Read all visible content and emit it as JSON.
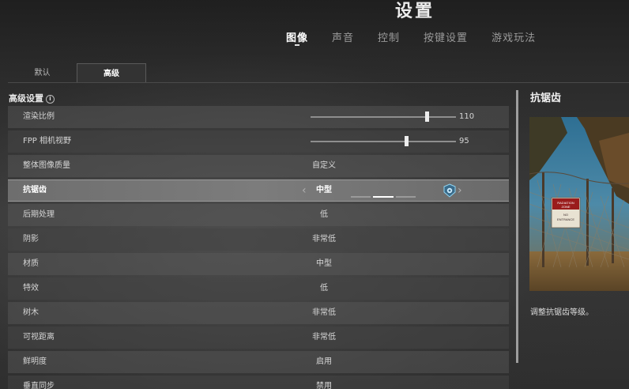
{
  "header": {
    "title": "设置",
    "tabs": [
      {
        "label": "图像",
        "active": true
      },
      {
        "label": "声音",
        "active": false
      },
      {
        "label": "控制",
        "active": false
      },
      {
        "label": "按键设置",
        "active": false
      },
      {
        "label": "游戏玩法",
        "active": false
      }
    ]
  },
  "subtabs": [
    {
      "label": "默认",
      "active": false
    },
    {
      "label": "高级",
      "active": true
    }
  ],
  "section": {
    "title": "高级设置",
    "info_icon": "i"
  },
  "settings": [
    {
      "label": "渲染比例",
      "type": "slider",
      "value": "110",
      "fraction": 0.8
    },
    {
      "label": "FPP 相机视野",
      "type": "slider",
      "value": "95",
      "fraction": 0.66
    },
    {
      "label": "整体图像质量",
      "type": "option",
      "value": "自定义"
    },
    {
      "label": "抗锯齿",
      "type": "selector",
      "value": "中型",
      "selected": true,
      "level": 2,
      "levels": 3,
      "left_arrow": "‹",
      "right_arrow": "›"
    },
    {
      "label": "后期处理",
      "type": "option",
      "value": "低"
    },
    {
      "label": "阴影",
      "type": "option",
      "value": "非常低"
    },
    {
      "label": "材质",
      "type": "option",
      "value": "中型"
    },
    {
      "label": "特效",
      "type": "option",
      "value": "低"
    },
    {
      "label": "树木",
      "type": "option",
      "value": "非常低"
    },
    {
      "label": "可视距离",
      "type": "option",
      "value": "非常低"
    },
    {
      "label": "鲜明度",
      "type": "option",
      "value": "启用"
    },
    {
      "label": "垂直同步",
      "type": "option",
      "value": "禁用"
    }
  ],
  "detail": {
    "title": "抗锯齿",
    "description": "调整抗锯齿等级。",
    "preview_sign": {
      "line1": "RADIATION",
      "line2": "ZONE",
      "line3": "NO",
      "line4": "ENTRANCE"
    }
  },
  "colors": {
    "background": "#2a2a2a",
    "row": "#5a5a5a",
    "selected_row": "#7a7a7a",
    "text": "#d8d8d8",
    "sign_red": "#9a1c1c"
  },
  "icons": {
    "info": "info-icon",
    "gpu": "gpu-badge-icon",
    "arrow_left": "chevron-left-icon",
    "arrow_right": "chevron-right-icon"
  }
}
